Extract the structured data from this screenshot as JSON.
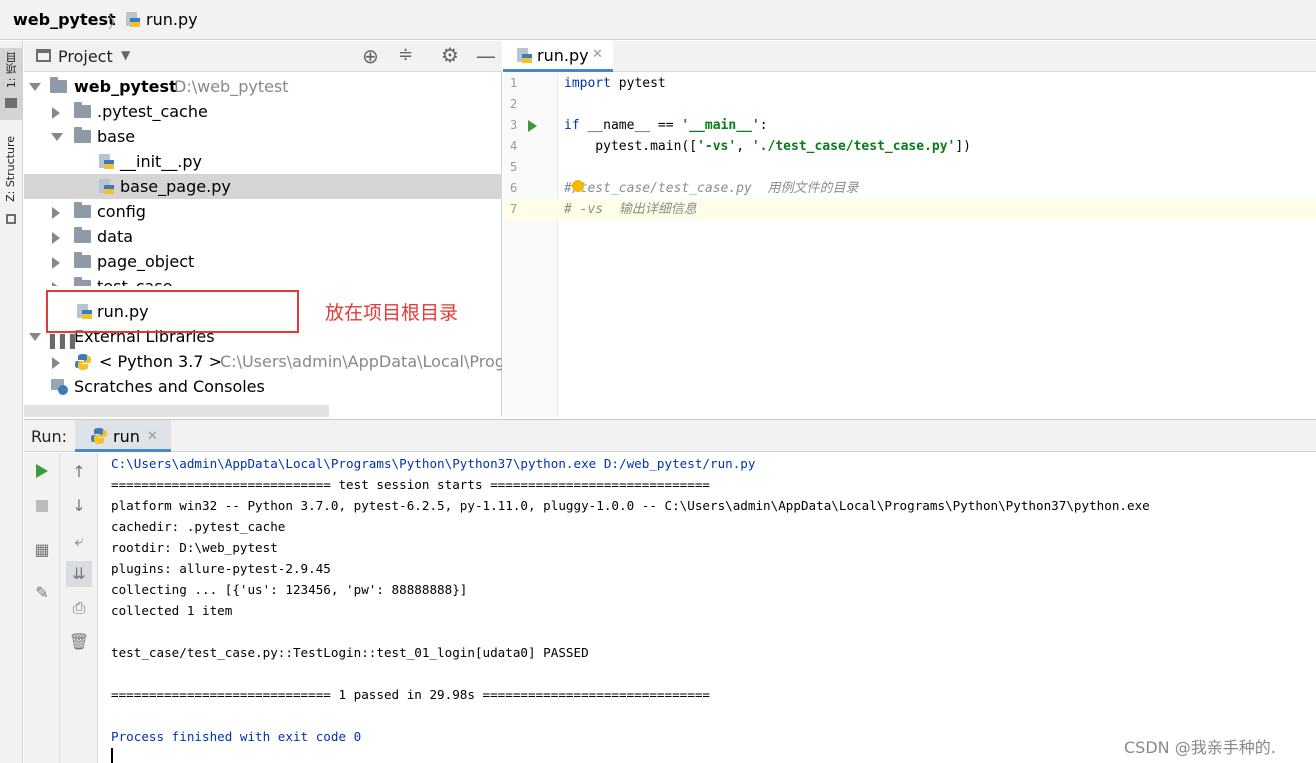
{
  "breadcrumb": {
    "project": "web_pytest",
    "separator": "〉",
    "file": "run.py"
  },
  "left_strip": {
    "project_tab": "1: 项目",
    "structure_tab": "Z: Structure"
  },
  "project_panel": {
    "title": "Project",
    "tree": [
      {
        "label": "web_pytest",
        "path": "D:\\web_pytest",
        "type": "root"
      },
      {
        "label": ".pytest_cache",
        "type": "folder"
      },
      {
        "label": "base",
        "type": "folder"
      },
      {
        "label": "__init__.py",
        "type": "file"
      },
      {
        "label": "base_page.py",
        "type": "file",
        "selected": true
      },
      {
        "label": "config",
        "type": "folder"
      },
      {
        "label": "data",
        "type": "folder"
      },
      {
        "label": "page_object",
        "type": "folder"
      },
      {
        "label": "test_case",
        "type": "folder"
      },
      {
        "label": "run.py",
        "type": "file"
      },
      {
        "label": "External Libraries",
        "type": "library"
      },
      {
        "label": "< Python 3.7 >",
        "path": "C:\\Users\\admin\\AppData\\Local\\Prog",
        "type": "python"
      },
      {
        "label": "Scratches and Consoles",
        "type": "scratches"
      }
    ]
  },
  "annotation": {
    "text": "放在项目根目录",
    "color": "#e53935"
  },
  "editor": {
    "tab_label": "run.py",
    "line_numbers": [
      "1",
      "2",
      "3",
      "4",
      "5",
      "6",
      "7"
    ],
    "lines": {
      "l1_kw": "import",
      "l1_rest": " pytest",
      "l3_kw": "if",
      "l3_a": " __name__ == ",
      "l3_str": "'__main__'",
      "l3_b": ":",
      "l4_a": "    pytest.main([",
      "l4_s1": "'-vs'",
      "l4_b": ", ",
      "l4_s2": "'./test_case/test_case.py'",
      "l4_c": "])",
      "l6": "#/test_case/test_case.py  用例文件的目录",
      "l7": "# -vs  输出详细信息"
    }
  },
  "run_panel": {
    "label": "Run:",
    "tab_label": "run",
    "output": [
      "C:\\Users\\admin\\AppData\\Local\\Programs\\Python\\Python37\\python.exe D:/web_pytest/run.py",
      "============================= test session starts =============================",
      "platform win32 -- Python 3.7.0, pytest-6.2.5, py-1.11.0, pluggy-1.0.0 -- C:\\Users\\admin\\AppData\\Local\\Programs\\Python\\Python37\\python.exe",
      "cachedir: .pytest_cache",
      "rootdir: D:\\web_pytest",
      "plugins: allure-pytest-2.9.45",
      "collecting ... [{'us': 123456, 'pw': 88888888}]",
      "collected 1 item",
      "",
      "test_case/test_case.py::TestLogin::test_01_login[udata0] PASSED",
      "",
      "============================= 1 passed in 29.98s ==============================",
      "",
      "Process finished with exit code 0"
    ]
  },
  "watermark": "CSDN @我亲手种的.",
  "colors": {
    "accent": "#4a88c7",
    "annotation": "#e53935",
    "keyword": "#0033b3",
    "string": "#067d17"
  }
}
